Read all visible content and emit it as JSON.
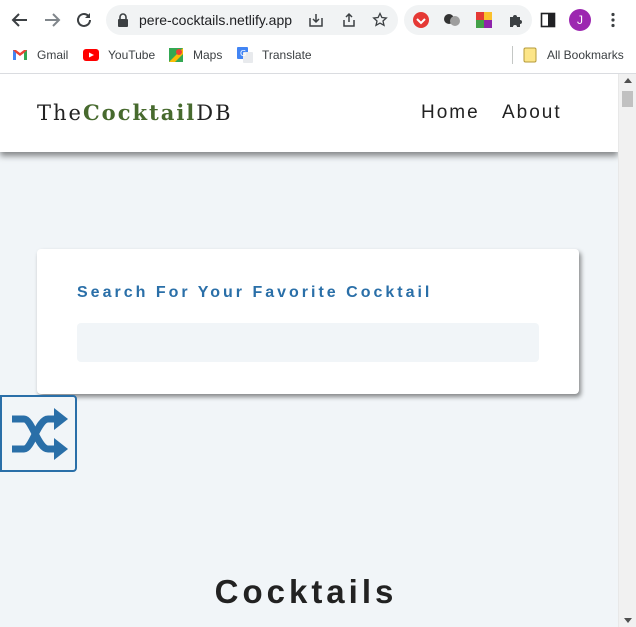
{
  "browser": {
    "url": "pere-cocktails.netlify.app",
    "profile_initial": "J",
    "bookmarks": [
      {
        "label": "Gmail",
        "icon": "gmail-icon"
      },
      {
        "label": "YouTube",
        "icon": "youtube-icon"
      },
      {
        "label": "Maps",
        "icon": "maps-icon"
      },
      {
        "label": "Translate",
        "icon": "translate-icon"
      }
    ],
    "all_bookmarks_label": "All Bookmarks"
  },
  "site": {
    "logo": {
      "prefix": "The",
      "accent": "Cocktail",
      "suffix": "DB"
    },
    "nav": {
      "home": "Home",
      "about": "About"
    },
    "search": {
      "label": "Search For Your Favorite Cocktail",
      "value": "",
      "placeholder": ""
    },
    "random_button_icon": "shuffle-icon",
    "section_title": "Cocktails"
  },
  "colors": {
    "accent_green": "#476a2e",
    "accent_blue": "#2a6fa8",
    "page_background": "#f1f5f8"
  }
}
